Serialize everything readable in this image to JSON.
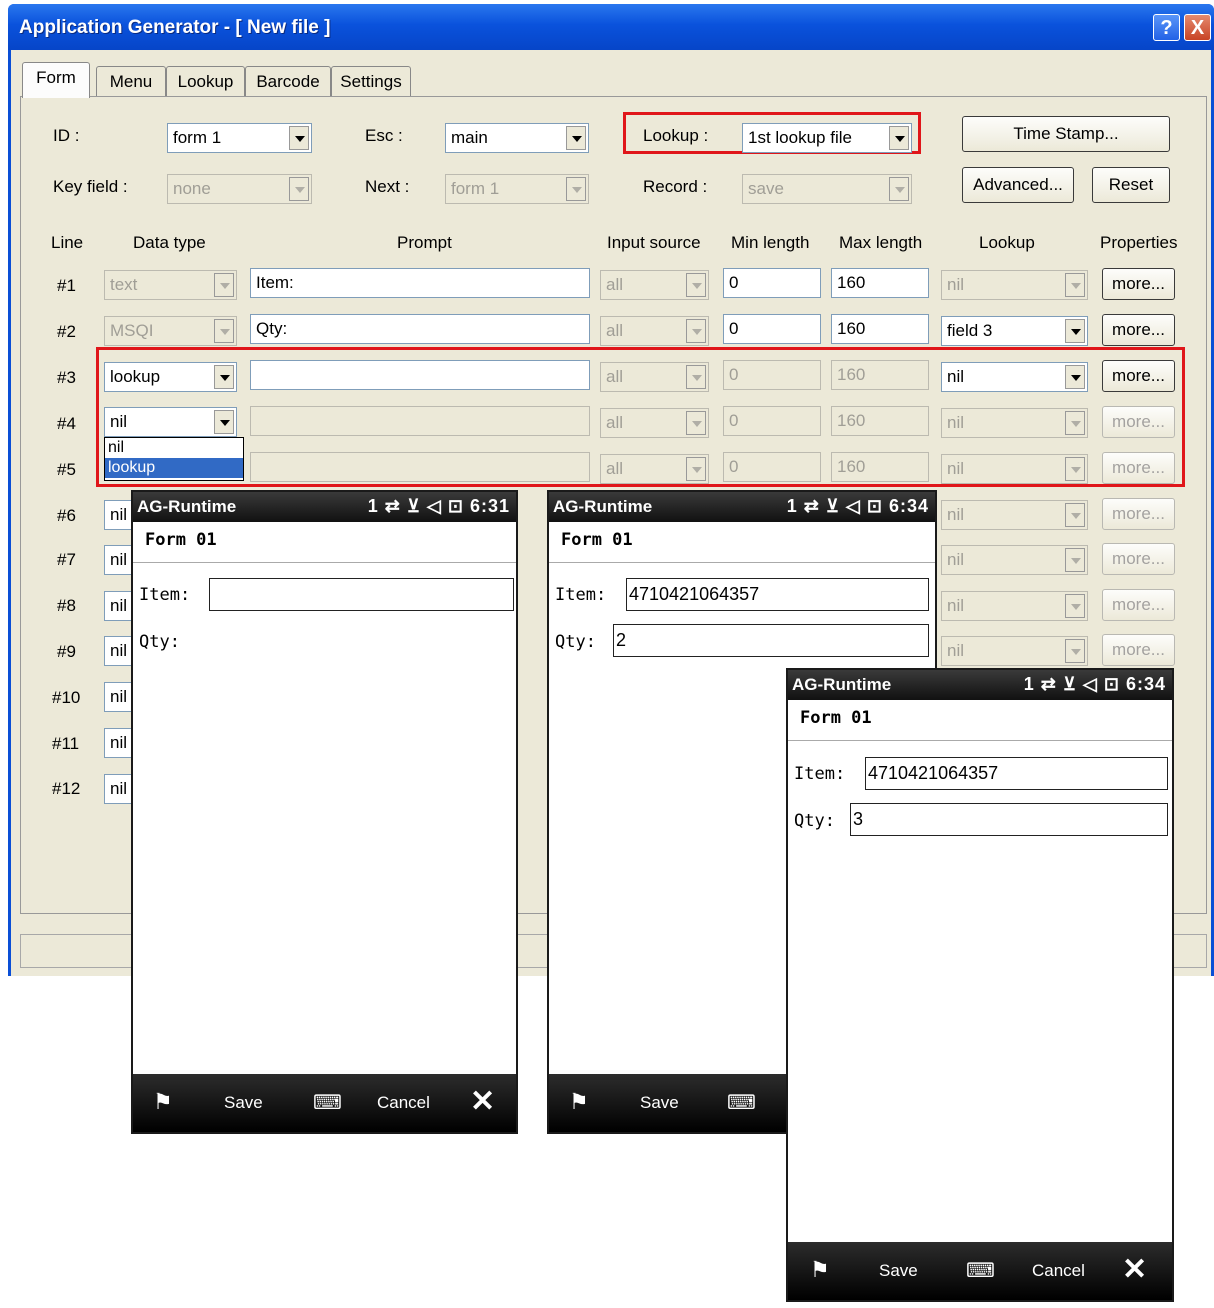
{
  "window": {
    "title": "Application Generator - [ New file ]",
    "help_label": "?",
    "close_label": "X"
  },
  "tabs": [
    "Form",
    "Menu",
    "Lookup",
    "Barcode",
    "Settings"
  ],
  "top": {
    "id_label": "ID :",
    "id_value": "form 1",
    "esc_label": "Esc :",
    "esc_value": "main",
    "lookup_label": "Lookup :",
    "lookup_value": "1st lookup file",
    "timestamp_button": "Time Stamp...",
    "keyfield_label": "Key field :",
    "keyfield_value": "none",
    "next_label": "Next :",
    "next_value": "form 1",
    "record_label": "Record :",
    "record_value": "save",
    "advanced_button": "Advanced...",
    "reset_button": "Reset"
  },
  "headers": {
    "line": "Line",
    "data_type": "Data type",
    "prompt": "Prompt",
    "input_source": "Input source",
    "min_length": "Min length",
    "max_length": "Max length",
    "lookup": "Lookup",
    "properties": "Properties"
  },
  "rows": [
    {
      "line": "#1",
      "data_type": "text",
      "prompt": "Item:",
      "input_source": "all",
      "min": "0",
      "max": "160",
      "lookup": "nil",
      "more": "more..."
    },
    {
      "line": "#2",
      "data_type": "MSQI",
      "prompt": "Qty:",
      "input_source": "all",
      "min": "0",
      "max": "160",
      "lookup": "field 3",
      "more": "more..."
    },
    {
      "line": "#3",
      "data_type": "lookup",
      "prompt": "",
      "input_source": "all",
      "min": "0",
      "max": "160",
      "lookup": "nil",
      "more": "more..."
    },
    {
      "line": "#4",
      "data_type": "nil",
      "prompt": "",
      "input_source": "all",
      "min": "0",
      "max": "160",
      "lookup": "nil",
      "more": "more..."
    },
    {
      "line": "#5",
      "data_type": "nil",
      "prompt": "",
      "input_source": "all",
      "min": "0",
      "max": "160",
      "lookup": "nil",
      "more": "more..."
    },
    {
      "line": "#6",
      "data_type": "nil",
      "lookup": "nil",
      "more": "more..."
    },
    {
      "line": "#7",
      "data_type": "nil",
      "lookup": "nil",
      "more": "more..."
    },
    {
      "line": "#8",
      "data_type": "nil",
      "lookup": "nil",
      "more": "more..."
    },
    {
      "line": "#9",
      "data_type": "nil",
      "lookup": "nil",
      "more": "more..."
    },
    {
      "line": "#10",
      "data_type": "nil"
    },
    {
      "line": "#11",
      "data_type": "nil"
    },
    {
      "line": "#12",
      "data_type": "nil"
    }
  ],
  "dropdown_options": [
    "nil",
    "lookup"
  ],
  "phones": [
    {
      "app": "AG-Runtime",
      "time": "6:31",
      "form": "Form 01",
      "item_label": "Item:",
      "item_value": "",
      "qty_label": "Qty:",
      "qty_value": "",
      "save": "Save",
      "cancel": "Cancel"
    },
    {
      "app": "AG-Runtime",
      "time": "6:34",
      "form": "Form 01",
      "item_label": "Item:",
      "item_value": "4710421064357",
      "qty_label": "Qty:",
      "qty_value": "2",
      "save": "Save"
    },
    {
      "app": "AG-Runtime",
      "time": "6:34",
      "form": "Form 01",
      "item_label": "Item:",
      "item_value": "4710421064357",
      "qty_label": "Qty:",
      "qty_value": "3",
      "save": "Save",
      "cancel": "Cancel"
    }
  ],
  "phone_status_icons": "1 ⇄ ⊻ ◁ ⊡",
  "icons": {
    "start": "windows-flag-icon",
    "keyboard": "keyboard-icon",
    "close": "close-x-icon"
  },
  "colors": {
    "title_bar": "#0a52dc",
    "highlight": "#e0161a",
    "selection": "#316ac5",
    "dialog_bg": "#ece9d8"
  }
}
